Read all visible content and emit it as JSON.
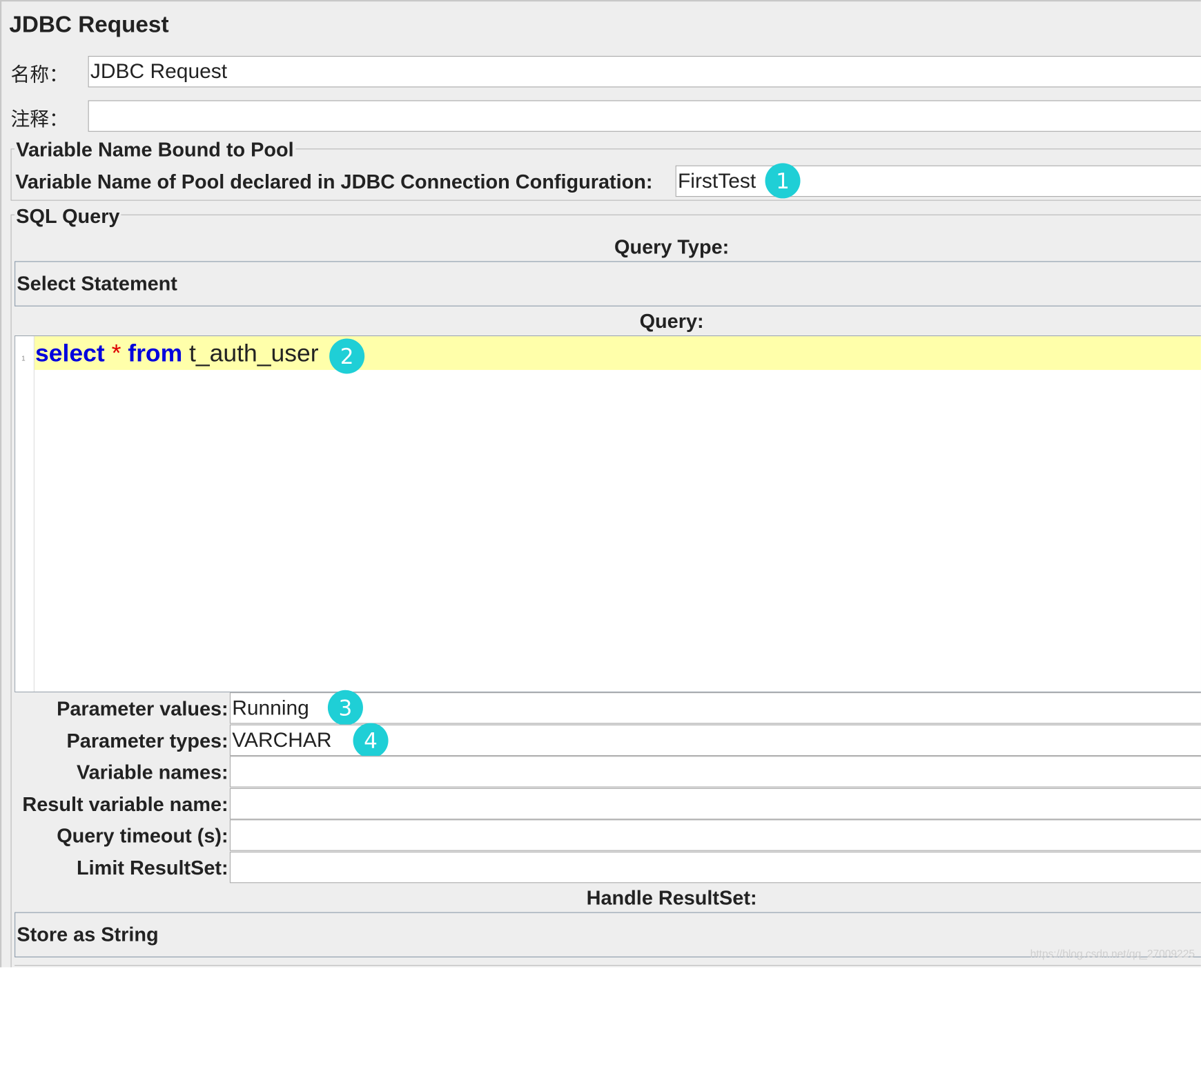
{
  "panel": {
    "title": "JDBC Request",
    "name_label": "名称：",
    "name_value": "JDBC Request",
    "comment_label": "注释：",
    "comment_value": ""
  },
  "pool_group": {
    "title": "Variable Name Bound to Pool",
    "pool_label": "Variable Name of Pool declared in JDBC Connection Configuration:",
    "pool_value": "FirstTest"
  },
  "sql_group": {
    "title": "SQL Query",
    "query_type_label": "Query Type:",
    "query_type_value": "Select Statement",
    "query_label": "Query:",
    "line_number": "1",
    "code": {
      "kw1": "select",
      "op": " * ",
      "kw2": "from",
      "rest": " t_auth_user"
    }
  },
  "params": {
    "parameter_values_label": "Parameter values:",
    "parameter_values_value": "Running",
    "parameter_types_label": "Parameter types:",
    "parameter_types_value": "VARCHAR",
    "variable_names_label": "Variable names:",
    "variable_names_value": "",
    "result_variable_label": "Result variable name:",
    "result_variable_value": "",
    "query_timeout_label": "Query timeout (s):",
    "query_timeout_value": "",
    "limit_resultset_label": "Limit ResultSet:",
    "limit_resultset_value": ""
  },
  "handle": {
    "label": "Handle ResultSet:",
    "value": "Store as String"
  },
  "annotations": [
    "1",
    "2",
    "3",
    "4"
  ],
  "watermark": "https://blog.csdn.net/qq_27009225",
  "colors": {
    "badge": "#1fcfd6",
    "keyword": "#0000dd",
    "operator": "#dd0000",
    "line_highlight": "#ffffaa",
    "panel_bg": "#eeeeee"
  }
}
